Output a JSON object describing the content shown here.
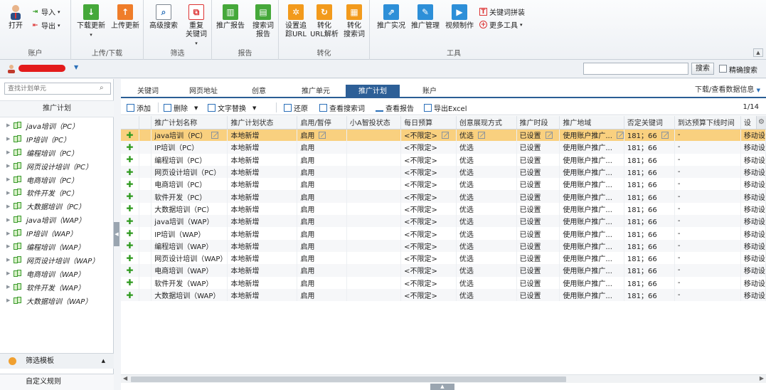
{
  "ribbon": {
    "open_label": "打开",
    "import_label": "导入",
    "export_label": "导出",
    "account_group": "账户",
    "download_update": "下载更新",
    "upload_update": "上传更新",
    "updown_group": "上传/下载",
    "advanced_search": "高级搜索",
    "duplicate_keywords_l1": "重复",
    "duplicate_keywords_l2": "关键词",
    "filter_group": "筛选",
    "promo_report": "推广报告",
    "search_term_report_l1": "搜索词",
    "search_term_report_l2": "报告",
    "report_group": "报告",
    "set_tracking_l1": "设置追",
    "set_tracking_l2": "踪URL",
    "convert_url_l1": "转化",
    "convert_url_l2": "URL解析",
    "convert_search_l1": "转化",
    "convert_search_l2": "搜索词",
    "conversion_group": "转化",
    "promo_live": "推广实况",
    "promo_manage": "推广管理",
    "video_make": "视频制作",
    "keyword_combine": "关键词拼装",
    "more_tools": "更多工具",
    "tools_group": "工具"
  },
  "account_bar": {
    "search_placeholder": "",
    "search_button": "搜索",
    "exact_search_label": "精确搜索"
  },
  "left_panel": {
    "search_placeholder": "查找计划单元",
    "title": "推广计划",
    "items": [
      {
        "label": "java培训（PC）"
      },
      {
        "label": "IP培训（PC）"
      },
      {
        "label": "编程培训（PC）"
      },
      {
        "label": "网页设计培训（PC）"
      },
      {
        "label": "电商培训（PC）"
      },
      {
        "label": "软件开发（PC）"
      },
      {
        "label": "大数据培训（PC）"
      },
      {
        "label": "java培训（WAP）"
      },
      {
        "label": "IP培训（WAP）"
      },
      {
        "label": "编程培训（WAP）"
      },
      {
        "label": "网页设计培训（WAP）"
      },
      {
        "label": "电商培训（WAP）"
      },
      {
        "label": "软件开发（WAP）"
      },
      {
        "label": "大数据培训（WAP）"
      }
    ],
    "filter_template": "筛选模板",
    "custom_rules": "自定义规则"
  },
  "tabs": [
    "关键词",
    "网页地址",
    "创意",
    "推广单元",
    "推广计划",
    "账户"
  ],
  "active_tab": 4,
  "download_view_label": "下载/查看数据信息",
  "toolbar": {
    "add": "添加",
    "delete": "删除",
    "text_replace": "文字替换",
    "restore": "还原",
    "view_search_terms": "查看搜索词",
    "view_report": "查看报告",
    "export_excel": "导出Excel",
    "pager": "1/14"
  },
  "grid": {
    "columns": [
      "推广计划名称",
      "推广计划状态",
      "启用/暂停",
      "小A智投状态",
      "每日预算",
      "创意展现方式",
      "推广时段",
      "推广地域",
      "否定关键词",
      "到达预算下线时间",
      "设"
    ],
    "rows": [
      {
        "name": "java培训（PC）",
        "status": "本地新增",
        "enabled": "启用",
        "smart": "",
        "budget": "<不限定>",
        "display": "优选",
        "schedule": "已设置",
        "region": "使用账户推广...",
        "negative": "181；66",
        "offline": "-",
        "device": "移动设"
      },
      {
        "name": "IP培训（PC）",
        "status": "本地新增",
        "enabled": "启用",
        "smart": "",
        "budget": "<不限定>",
        "display": "优选",
        "schedule": "已设置",
        "region": "使用账户推广...",
        "negative": "181；66",
        "offline": "-",
        "device": "移动设"
      },
      {
        "name": "编程培训（PC）",
        "status": "本地新增",
        "enabled": "启用",
        "smart": "",
        "budget": "<不限定>",
        "display": "优选",
        "schedule": "已设置",
        "region": "使用账户推广...",
        "negative": "181；66",
        "offline": "-",
        "device": "移动设"
      },
      {
        "name": "网页设计培训（PC）",
        "status": "本地新增",
        "enabled": "启用",
        "smart": "",
        "budget": "<不限定>",
        "display": "优选",
        "schedule": "已设置",
        "region": "使用账户推广...",
        "negative": "181；66",
        "offline": "-",
        "device": "移动设"
      },
      {
        "name": "电商培训（PC）",
        "status": "本地新增",
        "enabled": "启用",
        "smart": "",
        "budget": "<不限定>",
        "display": "优选",
        "schedule": "已设置",
        "region": "使用账户推广...",
        "negative": "181；66",
        "offline": "-",
        "device": "移动设"
      },
      {
        "name": "软件开发（PC）",
        "status": "本地新增",
        "enabled": "启用",
        "smart": "",
        "budget": "<不限定>",
        "display": "优选",
        "schedule": "已设置",
        "region": "使用账户推广...",
        "negative": "181；66",
        "offline": "-",
        "device": "移动设"
      },
      {
        "name": "大数据培训（PC）",
        "status": "本地新增",
        "enabled": "启用",
        "smart": "",
        "budget": "<不限定>",
        "display": "优选",
        "schedule": "已设置",
        "region": "使用账户推广...",
        "negative": "181；66",
        "offline": "-",
        "device": "移动设"
      },
      {
        "name": "java培训（WAP）",
        "status": "本地新增",
        "enabled": "启用",
        "smart": "",
        "budget": "<不限定>",
        "display": "优选",
        "schedule": "已设置",
        "region": "使用账户推广...",
        "negative": "181；66",
        "offline": "-",
        "device": "移动设"
      },
      {
        "name": "IP培训（WAP）",
        "status": "本地新增",
        "enabled": "启用",
        "smart": "",
        "budget": "<不限定>",
        "display": "优选",
        "schedule": "已设置",
        "region": "使用账户推广...",
        "negative": "181；66",
        "offline": "-",
        "device": "移动设"
      },
      {
        "name": "编程培训（WAP）",
        "status": "本地新增",
        "enabled": "启用",
        "smart": "",
        "budget": "<不限定>",
        "display": "优选",
        "schedule": "已设置",
        "region": "使用账户推广...",
        "negative": "181；66",
        "offline": "-",
        "device": "移动设"
      },
      {
        "name": "网页设计培训（WAP）",
        "status": "本地新增",
        "enabled": "启用",
        "smart": "",
        "budget": "<不限定>",
        "display": "优选",
        "schedule": "已设置",
        "region": "使用账户推广...",
        "negative": "181；66",
        "offline": "-",
        "device": "移动设"
      },
      {
        "name": "电商培训（WAP）",
        "status": "本地新增",
        "enabled": "启用",
        "smart": "",
        "budget": "<不限定>",
        "display": "优选",
        "schedule": "已设置",
        "region": "使用账户推广...",
        "negative": "181；66",
        "offline": "-",
        "device": "移动设"
      },
      {
        "name": "软件开发（WAP）",
        "status": "本地新增",
        "enabled": "启用",
        "smart": "",
        "budget": "<不限定>",
        "display": "优选",
        "schedule": "已设置",
        "region": "使用账户推广...",
        "negative": "181；66",
        "offline": "-",
        "device": "移动设"
      },
      {
        "name": "大数据培训（WAP）",
        "status": "本地新增",
        "enabled": "启用",
        "smart": "",
        "budget": "<不限定>",
        "display": "优选",
        "schedule": "已设置",
        "region": "使用账户推广...",
        "negative": "181；66",
        "offline": "-",
        "device": "移动设"
      }
    ],
    "selected_row": 0
  },
  "colors": {
    "accent": "#2d5f97",
    "selected_row": "#f9d07f",
    "add_green": "#2f9a1f"
  }
}
